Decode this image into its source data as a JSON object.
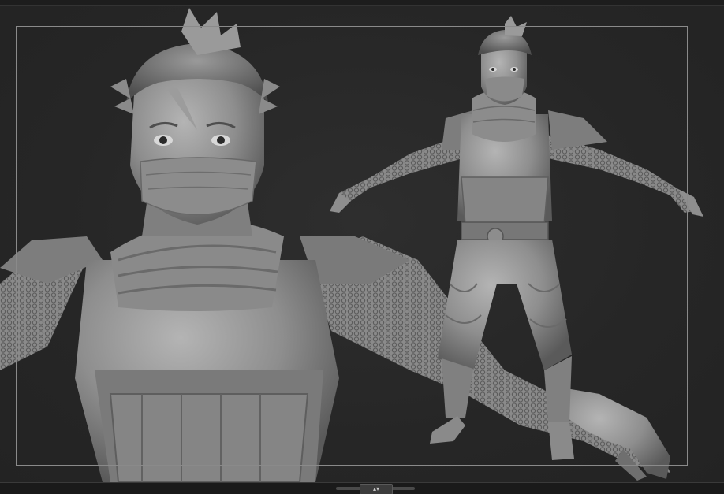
{
  "viewport": {
    "background_color": "#262626",
    "frame_color": "#8a8a8a",
    "clay_color": "#8e8e8e"
  },
  "bottom_tray": {
    "toggle_icon": "up-down-arrows-icon",
    "toggle_glyph": "▴▾"
  }
}
